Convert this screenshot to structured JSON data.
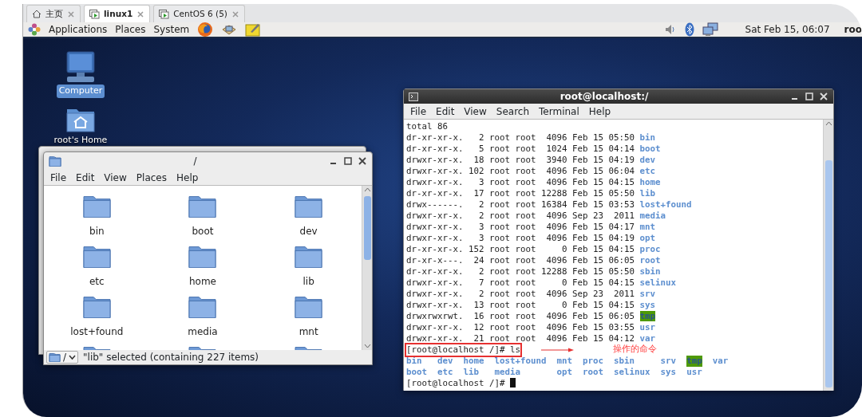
{
  "browser_tabs": [
    {
      "label": "主页",
      "kind": "home",
      "selected": false
    },
    {
      "label": "linux1",
      "kind": "vm",
      "selected": true
    },
    {
      "label": "CentOS 6 (5)",
      "kind": "vm",
      "selected": false
    }
  ],
  "panel": {
    "menus": [
      "Applications",
      "Places",
      "System"
    ],
    "clock": "Sat Feb 15, 06:07",
    "user": "roo"
  },
  "desktop_icons": [
    {
      "label": "Computer",
      "kind": "computer",
      "selected": true
    },
    {
      "label": "root's Home",
      "kind": "home",
      "selected": false
    }
  ],
  "file_manager": {
    "title": "/",
    "menu": [
      "File",
      "Edit",
      "View",
      "Places",
      "Help"
    ],
    "items": [
      {
        "name": "bin"
      },
      {
        "name": "boot"
      },
      {
        "name": "dev"
      },
      {
        "name": "etc"
      },
      {
        "name": "home"
      },
      {
        "name": "lib"
      },
      {
        "name": "lost+found"
      },
      {
        "name": "media"
      },
      {
        "name": "mnt"
      }
    ],
    "location": "/",
    "status": "\"lib\" selected (containing 227 items)"
  },
  "terminal": {
    "title": "root@localhost:/",
    "menu": [
      "File",
      "Edit",
      "View",
      "Search",
      "Terminal",
      "Help"
    ],
    "lines": [
      {
        "kind": "text",
        "text": "total 86"
      },
      {
        "kind": "entry",
        "details": "dr-xr-xr-x.   2 root root  4096 Feb 15 05:50",
        "name": "bin",
        "highlight": false
      },
      {
        "kind": "entry",
        "details": "dr-xr-xr-x.   5 root root  1024 Feb 15 04:14",
        "name": "boot",
        "highlight": false
      },
      {
        "kind": "entry",
        "details": "drwxr-xr-x.  18 root root  3940 Feb 15 04:19",
        "name": "dev",
        "highlight": false
      },
      {
        "kind": "entry",
        "details": "drwxr-xr-x. 102 root root  4096 Feb 15 06:04",
        "name": "etc",
        "highlight": false
      },
      {
        "kind": "entry",
        "details": "drwxr-xr-x.   3 root root  4096 Feb 15 04:15",
        "name": "home",
        "highlight": false
      },
      {
        "kind": "entry",
        "details": "dr-xr-xr-x.  17 root root 12288 Feb 15 05:50",
        "name": "lib",
        "highlight": false
      },
      {
        "kind": "entry",
        "details": "drwx------.   2 root root 16384 Feb 15 03:53",
        "name": "lost+found",
        "highlight": false
      },
      {
        "kind": "entry",
        "details": "drwxr-xr-x.   2 root root  4096 Sep 23  2011",
        "name": "media",
        "highlight": false
      },
      {
        "kind": "entry",
        "details": "drwxr-xr-x.   3 root root  4096 Feb 15 04:17",
        "name": "mnt",
        "highlight": false
      },
      {
        "kind": "entry",
        "details": "drwxr-xr-x.   3 root root  4096 Feb 15 04:19",
        "name": "opt",
        "highlight": false
      },
      {
        "kind": "entry",
        "details": "dr-xr-xr-x. 152 root root     0 Feb 15 04:15",
        "name": "proc",
        "highlight": false
      },
      {
        "kind": "entry",
        "details": "dr-xr-x---.  24 root root  4096 Feb 15 06:05",
        "name": "root",
        "highlight": false
      },
      {
        "kind": "entry",
        "details": "dr-xr-xr-x.   2 root root 12288 Feb 15 05:50",
        "name": "sbin",
        "highlight": false
      },
      {
        "kind": "entry",
        "details": "drwxr-xr-x.   7 root root     0 Feb 15 04:15",
        "name": "selinux",
        "highlight": false
      },
      {
        "kind": "entry",
        "details": "drwxr-xr-x.   2 root root  4096 Sep 23  2011",
        "name": "srv",
        "highlight": false
      },
      {
        "kind": "entry",
        "details": "drwxr-xr-x.  13 root root     0 Feb 15 04:15",
        "name": "sys",
        "highlight": false
      },
      {
        "kind": "entry",
        "details": "drwxrwxrwt.  16 root root  4096 Feb 15 06:05",
        "name": "tmp",
        "highlight": true
      },
      {
        "kind": "entry",
        "details": "drwxr-xr-x.  12 root root  4096 Feb 15 03:55",
        "name": "usr",
        "highlight": false
      },
      {
        "kind": "entry",
        "details": "drwxr-xr-x.  21 root root  4096 Feb 15 04:12",
        "name": "var",
        "highlight": false
      },
      {
        "kind": "prompt",
        "text": "[root@localhost /]# ls",
        "annotation": "操作的命令"
      },
      {
        "kind": "columns",
        "columns": [
          [
            {
              "name": "bin",
              "highlight": false
            },
            {
              "name": "boot",
              "highlight": false
            }
          ],
          [
            {
              "name": "dev",
              "highlight": false
            },
            {
              "name": "etc",
              "highlight": false
            }
          ],
          [
            {
              "name": "home",
              "highlight": false
            },
            {
              "name": "lib",
              "highlight": false
            }
          ],
          [
            {
              "name": "lost+found",
              "highlight": false
            },
            {
              "name": "media",
              "highlight": false
            }
          ],
          [
            {
              "name": "mnt",
              "highlight": false
            },
            {
              "name": "opt",
              "highlight": false
            }
          ],
          [
            {
              "name": "proc",
              "highlight": false
            },
            {
              "name": "root",
              "highlight": false
            }
          ],
          [
            {
              "name": "sbin",
              "highlight": false
            },
            {
              "name": "selinux",
              "highlight": false
            }
          ],
          [
            {
              "name": "srv",
              "highlight": false
            },
            {
              "name": "sys",
              "highlight": false
            }
          ],
          [
            {
              "name": "tmp",
              "highlight": true
            },
            {
              "name": "usr",
              "highlight": false
            }
          ],
          [
            {
              "name": "var",
              "highlight": false
            }
          ]
        ]
      },
      {
        "kind": "prompt",
        "text": "[root@localhost /]#",
        "cursor": true
      }
    ]
  }
}
